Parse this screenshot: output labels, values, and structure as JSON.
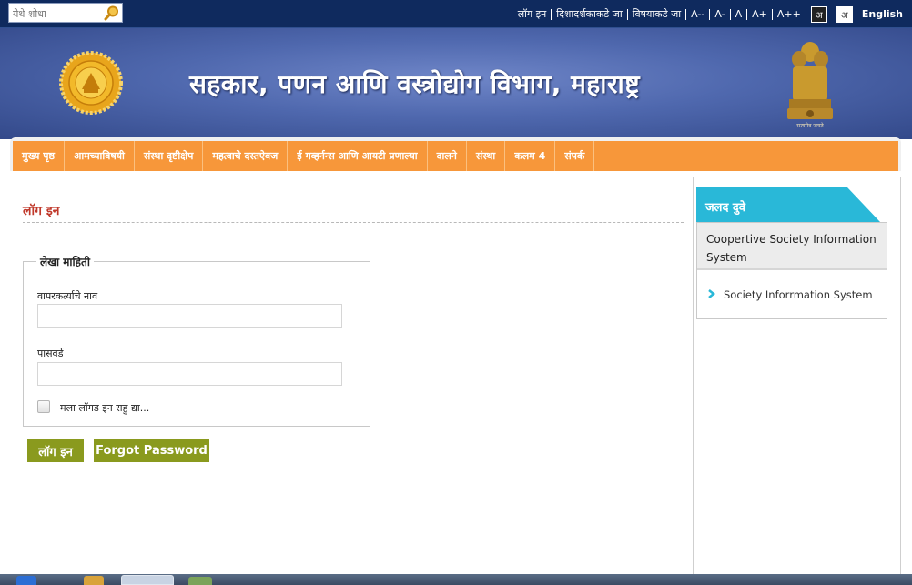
{
  "search": {
    "placeholder": "येथे शोधा"
  },
  "top_links": {
    "login": "लॉग इन",
    "directions": "दिशादर्शकाकडे जा",
    "subjects": "विषयाकडे जा",
    "font_smaller": "A--",
    "font_small": "A-",
    "font_normal": "A",
    "font_large": "A+",
    "font_larger": "A++",
    "theme_dark": "अ",
    "theme_light": "अ",
    "english": "English"
  },
  "header": {
    "title": "सहकार, पणन आणि वस्त्रोद्योग विभाग, महाराष्ट्र",
    "emblem_motto": "सत्यमेव जयते"
  },
  "nav": [
    {
      "label": "मुख्य पृष्ठ"
    },
    {
      "label": "आमच्याविषयी"
    },
    {
      "label": "संस्था दृष्टीक्षेप"
    },
    {
      "label": "महत्वाचे दस्तऐवज"
    },
    {
      "label": "ई गव्हर्नन्स आणि आयटी प्रणाल्या"
    },
    {
      "label": "दालने"
    },
    {
      "label": "संस्था"
    },
    {
      "label": "कलम 4"
    },
    {
      "label": "संपर्क"
    }
  ],
  "login": {
    "heading": "लॉग इन",
    "legend": "लेखा माहिती",
    "username_label": "वापरकर्त्याचे नाव",
    "password_label": "पासवर्ड",
    "remember_label": "मला लॉगड इन राहु द्या...",
    "login_button": "लॉग इन",
    "forgot_button": "Forgot Password"
  },
  "quick_links": {
    "title": "जलद दुवे",
    "section": "Coopertive Society Information System",
    "link": "Society Inforrmation System"
  },
  "colors": {
    "topbar": "#0f2a5e",
    "nav": "#f7973a",
    "button": "#8a9a1e",
    "quicklinks_tab": "#29b8d8",
    "heading": "#c0392b"
  }
}
